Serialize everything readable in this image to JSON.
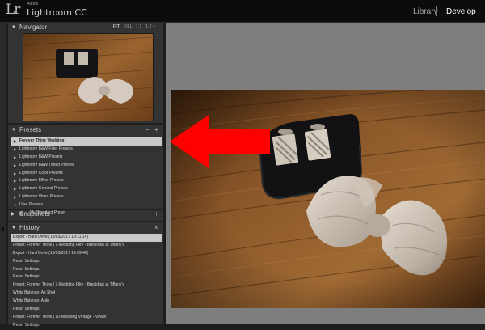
{
  "app": {
    "logo_text": "Lr",
    "brand_small": "Adobe",
    "brand_name": "Lightroom CC"
  },
  "modules": [
    {
      "label": "Library",
      "active": false
    },
    {
      "label": "Develop",
      "active": true
    }
  ],
  "navigator": {
    "title": "Navigator",
    "zoom_options": [
      "FIT",
      "FILL",
      "1:1",
      "1:2 ÷"
    ]
  },
  "presets": {
    "title": "Presets",
    "items": [
      {
        "label": "Forever Thine Wedding",
        "selected": true
      },
      {
        "label": "Lightroom B&W Filter Presets"
      },
      {
        "label": "Lightroom B&W Presets"
      },
      {
        "label": "Lightroom B&W Toned Presets"
      },
      {
        "label": "Lightroom Color Presets"
      },
      {
        "label": "Lightroom Effect Presets"
      },
      {
        "label": "Lightroom General Presets"
      },
      {
        "label": "Lightroom Video Presets"
      },
      {
        "label": "User Presets",
        "expanded": true
      },
      {
        "label": "My Standard Preset",
        "child": true
      }
    ]
  },
  "snapshots": {
    "title": "Snapshots"
  },
  "history": {
    "title": "History",
    "items": [
      {
        "label": "Export - Hard Drive (13/03/2017 19:11:14)",
        "selected": true
      },
      {
        "label": "Preset: Forever Thine | 7-Wedding Film - Breakfast at Tiffany's"
      },
      {
        "label": "Export - Hard Drive (13/03/2017 19:09:40)"
      },
      {
        "label": "Reset Settings"
      },
      {
        "label": "Reset Settings"
      },
      {
        "label": "Reset Settings"
      },
      {
        "label": "Preset: Forever Thine | 7-Wedding Film - Breakfast at Tiffany's"
      },
      {
        "label": "White Balance: As Shot"
      },
      {
        "label": "White Balance: Auto"
      },
      {
        "label": "Reset Settings"
      },
      {
        "label": "Preset: Forever Thine | 10-Wedding Vintage - Velvet"
      },
      {
        "label": "Reset Settings"
      }
    ]
  },
  "colors": {
    "annotation_arrow": "#ff0000",
    "selected_row": "#c9c9c9",
    "panel_bg": "#333333",
    "main_bg": "#7e7e7e"
  }
}
